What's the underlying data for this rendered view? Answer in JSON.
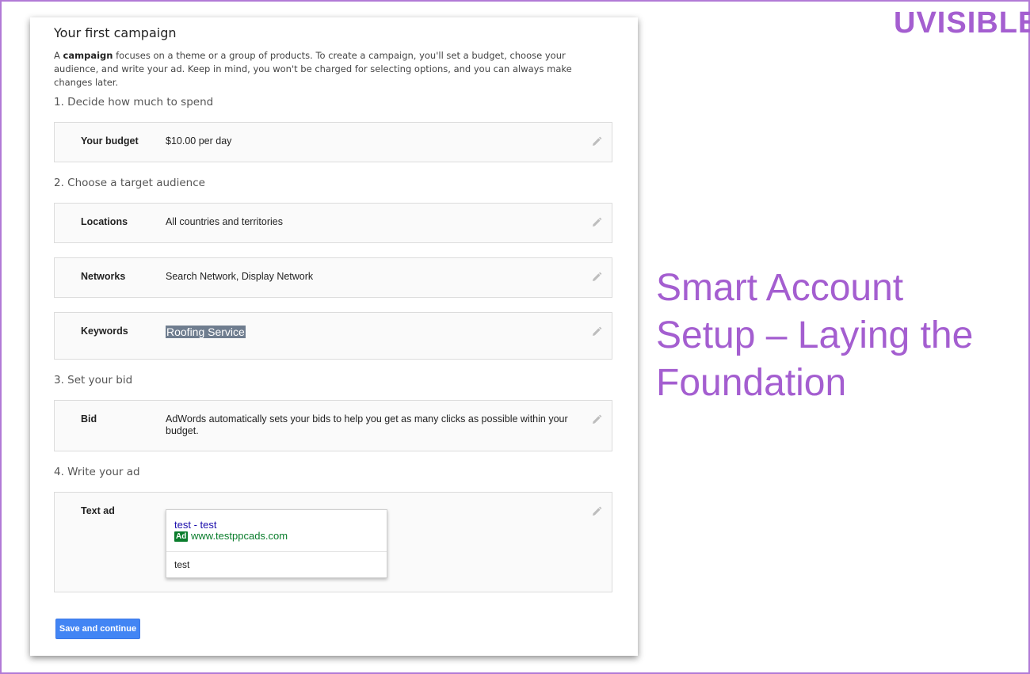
{
  "branding": {
    "logo_text": "UVISIBLE",
    "brand_color": "#a45ed0"
  },
  "slide": {
    "headline": "Smart Account Setup – Laying the Foundation"
  },
  "campaign": {
    "title": "Your first campaign",
    "intro_bold": "campaign",
    "intro_prefix": "A ",
    "intro_rest": " focuses on a theme or a group of products. To create a campaign, you'll set a budget, choose your audience, and write your ad. Keep in mind, you won't be charged for selecting options, and you can always make changes later.",
    "steps": [
      {
        "title": "1. Decide how much to spend"
      },
      {
        "title": "2. Choose a target audience"
      },
      {
        "title": "3. Set your bid"
      },
      {
        "title": "4. Write your ad"
      }
    ],
    "rows": {
      "budget": {
        "label": "Your budget",
        "value": "$10.00 per day"
      },
      "locations": {
        "label": "Locations",
        "value": "All countries and territories"
      },
      "networks": {
        "label": "Networks",
        "value": "Search Network, Display Network"
      },
      "keywords": {
        "label": "Keywords",
        "value": "Roofing Service"
      },
      "bid": {
        "label": "Bid",
        "value": "AdWords automatically sets your bids to help you get as many clicks as possible within your budget."
      },
      "text_ad": {
        "label": "Text ad"
      }
    },
    "ad_preview": {
      "headline": "test - test",
      "badge": "Ad",
      "display_url": "www.testppcads.com",
      "description": "test"
    },
    "edit_icon": "pencil-icon",
    "save_button_label": "Save and continue",
    "accent_color": "#4285f4"
  }
}
